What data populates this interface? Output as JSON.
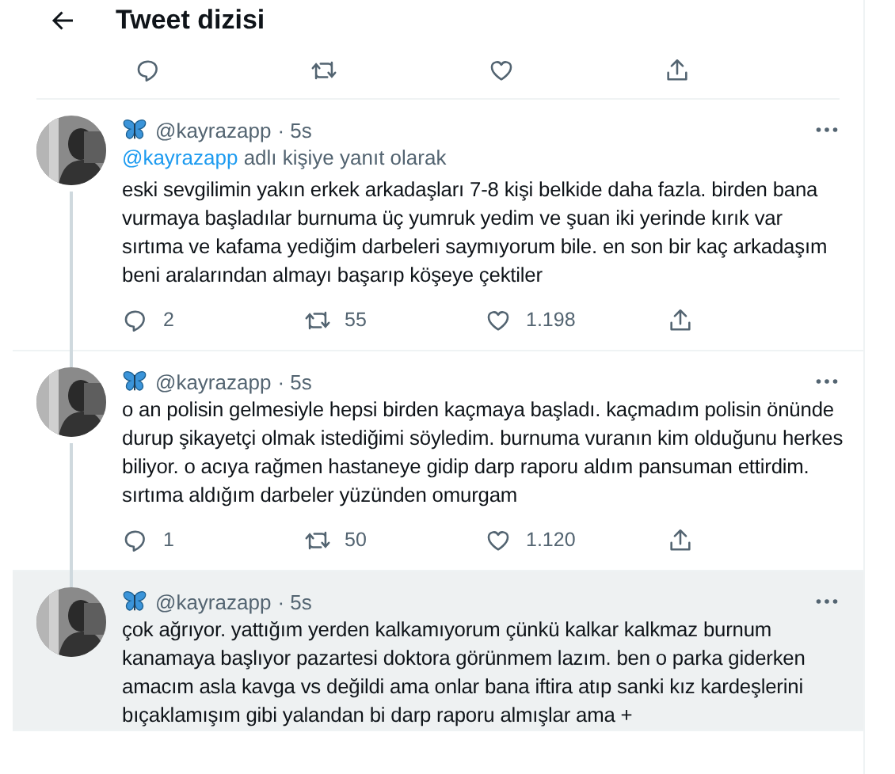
{
  "header": {
    "title": "Tweet dizisi"
  },
  "tweets": [
    {
      "handle": "@kayrazapp",
      "time": "· 5s",
      "reply_to": {
        "mention": "@kayrazapp",
        "text": "adlı kişiye yanıt olarak"
      },
      "text": "eski sevgilimin yakın erkek arkadaşları 7-8 kişi belkide daha fazla. birden bana vurmaya başladılar burnuma üç yumruk yedim ve şuan iki yerinde kırık var sırtıma ve kafama yediğim darbeleri saymıyorum bile. en son bir kaç arkadaşım beni aralarından almayı başarıp köşeye çektiler",
      "counts": {
        "replies": "2",
        "retweets": "55",
        "likes": "1.198"
      },
      "highlighted": false
    },
    {
      "handle": "@kayrazapp",
      "time": "· 5s",
      "text": "o an polisin gelmesiyle hepsi birden kaçmaya başladı. kaçmadım polisin önünde durup şikayetçi olmak istediğimi söyledim. burnuma vuranın kim olduğunu herkes biliyor. o acıya rağmen hastaneye gidip darp raporu aldım pansuman ettirdim. sırtıma aldığım darbeler yüzünden omurgam",
      "counts": {
        "replies": "1",
        "retweets": "50",
        "likes": "1.120"
      },
      "highlighted": false
    },
    {
      "handle": "@kayrazapp",
      "time": "· 5s",
      "text": "çok ağrıyor. yattığım yerden kalkamıyorum çünkü kalkar kalkmaz burnum kanamaya başlıyor pazartesi doktora görünmem lazım. ben o parka giderken amacım asla kavga vs değildi ama onlar bana iftira atıp sanki kız kardeşlerini bıçaklamışım gibi yalandan bi darp raporu almışlar ama +",
      "highlighted": true
    }
  ]
}
